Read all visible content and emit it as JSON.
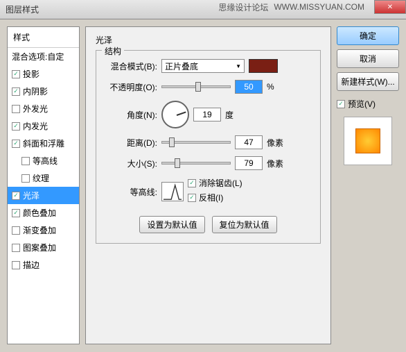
{
  "title": "图层样式",
  "watermark1": "思缘设计论坛",
  "watermark2": "WWW.MISSYUAN.COM",
  "styles_header": "样式",
  "styles": [
    {
      "label": "混合选项:自定",
      "checked": null,
      "selected": false,
      "indent": false
    },
    {
      "label": "投影",
      "checked": true,
      "selected": false,
      "indent": false
    },
    {
      "label": "内阴影",
      "checked": true,
      "selected": false,
      "indent": false
    },
    {
      "label": "外发光",
      "checked": false,
      "selected": false,
      "indent": false
    },
    {
      "label": "内发光",
      "checked": true,
      "selected": false,
      "indent": false
    },
    {
      "label": "斜面和浮雕",
      "checked": true,
      "selected": false,
      "indent": false
    },
    {
      "label": "等高线",
      "checked": false,
      "selected": false,
      "indent": true
    },
    {
      "label": "纹理",
      "checked": false,
      "selected": false,
      "indent": true
    },
    {
      "label": "光泽",
      "checked": true,
      "selected": true,
      "indent": false
    },
    {
      "label": "颜色叠加",
      "checked": true,
      "selected": false,
      "indent": false
    },
    {
      "label": "渐变叠加",
      "checked": false,
      "selected": false,
      "indent": false
    },
    {
      "label": "图案叠加",
      "checked": false,
      "selected": false,
      "indent": false
    },
    {
      "label": "描边",
      "checked": false,
      "selected": false,
      "indent": false
    }
  ],
  "section_title": "光泽",
  "fieldset_title": "结构",
  "labels": {
    "blend": "混合模式(B):",
    "opacity": "不透明度(O):",
    "angle": "角度(N):",
    "distance": "距离(D):",
    "size": "大小(S):",
    "contour": "等高线:",
    "antialias": "消除锯齿(L)",
    "invert": "反相(I)"
  },
  "values": {
    "blend_mode": "正片叠底",
    "opacity": "50",
    "angle": "19",
    "distance": "47",
    "size": "79",
    "color": "#7a1f14"
  },
  "units": {
    "percent": "%",
    "degree": "度",
    "pixel": "像素"
  },
  "buttons": {
    "default": "设置为默认值",
    "reset": "复位为默认值",
    "ok": "确定",
    "cancel": "取消",
    "newstyle": "新建样式(W)...",
    "preview": "预览(V)"
  }
}
